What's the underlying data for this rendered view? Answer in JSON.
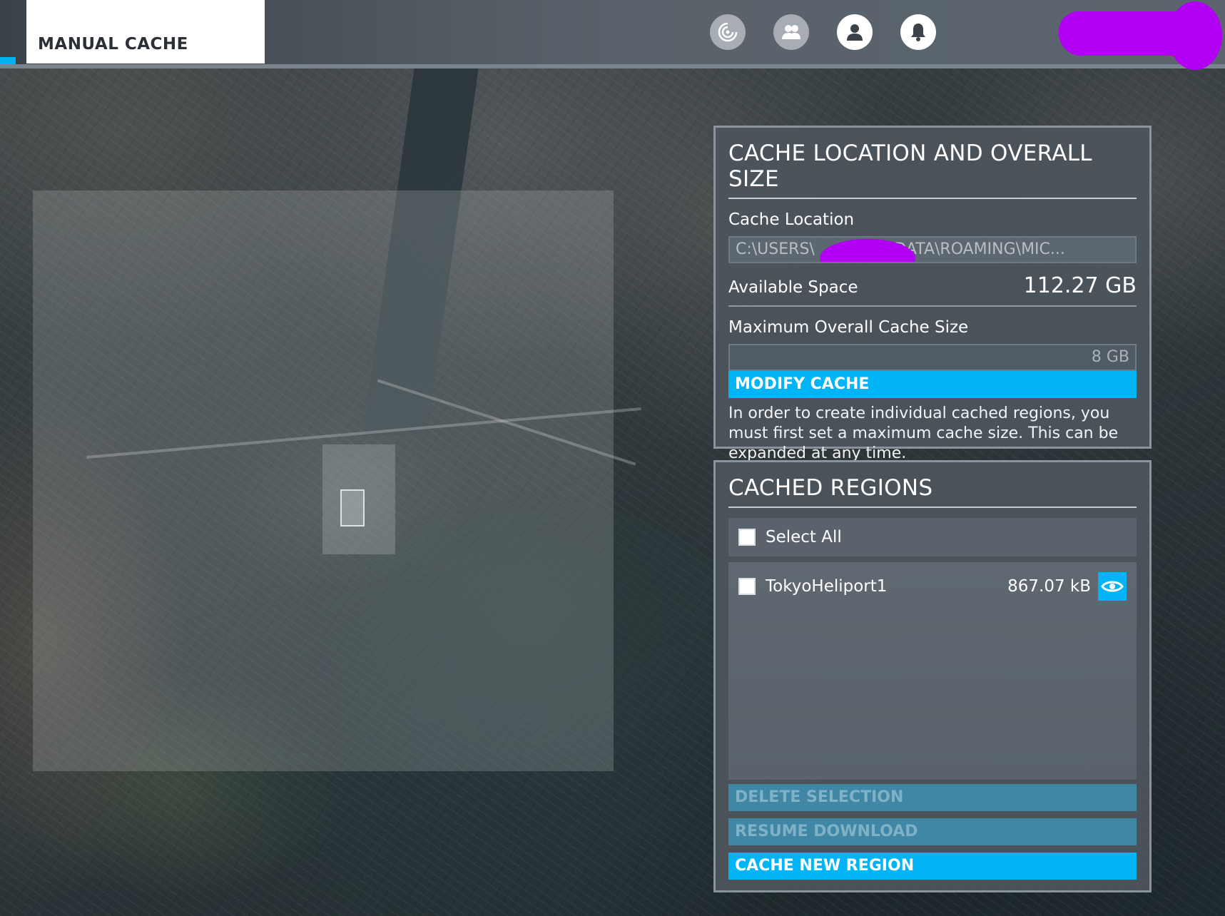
{
  "header": {
    "page_title": "MANUAL CACHE",
    "icons": [
      "activity-icon",
      "friends-icon",
      "profile-icon",
      "notifications-icon"
    ]
  },
  "cache_location_panel": {
    "title": "CACHE LOCATION AND OVERALL SIZE",
    "cache_location_label": "Cache Location",
    "cache_location_value": "C:\\USERS\\          APPDATA\\ROAMING\\MIC...",
    "available_space_label": "Available Space",
    "available_space_value": "112.27 GB",
    "max_size_label": "Maximum Overall Cache Size",
    "max_size_value": "8 GB",
    "modify_button": "MODIFY CACHE",
    "hint": "In order to create individual cached regions, you must first set a maximum cache size. This can be expanded at any time."
  },
  "cached_regions_panel": {
    "title": "CACHED REGIONS",
    "select_all_label": "Select All",
    "regions": [
      {
        "name": "TokyoHeliport1",
        "size": "867.07 kB"
      }
    ],
    "delete_button": "DELETE SELECTION",
    "resume_button": "RESUME DOWNLOAD",
    "new_region_button": "CACHE NEW REGION"
  },
  "colors": {
    "accent": "#00b4f5",
    "redaction": "#b100f3",
    "panel_bg": "#4c545c"
  }
}
